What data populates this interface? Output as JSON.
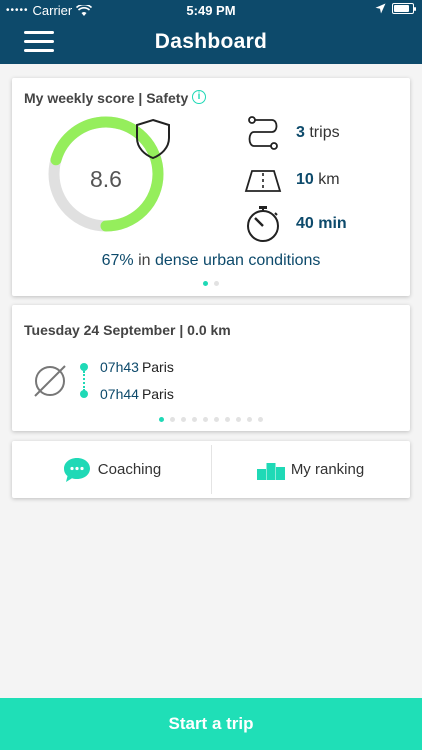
{
  "status_bar": {
    "dots": "•••••",
    "carrier": "Carrier",
    "time": "5:49 PM",
    "battery_level": 0.85
  },
  "header": {
    "title": "Dashboard"
  },
  "score_card": {
    "title": "My weekly score | Safety",
    "info_icon_text": "i",
    "score": "8.6",
    "score_fraction": 0.86,
    "trips": {
      "value": "3",
      "unit": "trips"
    },
    "distance": {
      "value": "10",
      "unit": "km"
    },
    "duration": {
      "value": "40",
      "unit": "min"
    },
    "urban": {
      "pct": "67%",
      "middle": "in",
      "label": "dense urban conditions"
    },
    "pager": {
      "count": 2,
      "active": 0
    }
  },
  "trip_card": {
    "title": "Tuesday 24 September | 0.0 km",
    "start": {
      "time": "07h43",
      "city": "Paris"
    },
    "end": {
      "time": "07h44",
      "city": "Paris"
    },
    "pager": {
      "count": 10,
      "active": 0
    }
  },
  "actions": {
    "coaching": "Coaching",
    "ranking": "My ranking"
  },
  "start_button": "Start a trip",
  "colors": {
    "primary": "#0d4a6b",
    "accent": "#1fd9b6",
    "gauge": "#95ee5c",
    "gauge_track": "#e0e0e0"
  }
}
